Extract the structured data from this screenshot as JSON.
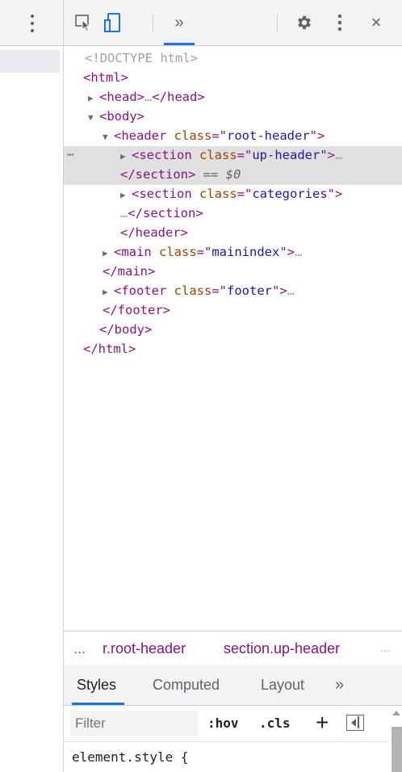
{
  "toolbar": {
    "icons": [
      "inspect-element-icon",
      "device-toolbar-icon"
    ],
    "more_tabs_label": "»",
    "close_label": "×"
  },
  "dom_tree": {
    "lines": [
      {
        "parts": [
          [
            "punct",
            "<!DOCTYPE html>"
          ]
        ]
      },
      {
        "parts": [
          [
            "tag",
            "<html"
          ],
          [
            "tag",
            ">"
          ]
        ]
      },
      {
        "parts": [
          [
            "tag",
            "<head>"
          ],
          [
            "punct",
            "…"
          ],
          [
            "tag",
            "</head>"
          ]
        ]
      },
      {
        "parts": [
          [
            "tag",
            "<body>"
          ]
        ]
      },
      {
        "parts": [
          [
            "tag",
            "<header "
          ],
          [
            "attr",
            "class"
          ],
          [
            "tag",
            "=\""
          ],
          [
            "val",
            "root-header"
          ],
          [
            "tag",
            "\">"
          ]
        ]
      },
      {
        "parts": [
          [
            "tag",
            "<section "
          ],
          [
            "attr",
            "class"
          ],
          [
            "tag",
            "=\""
          ],
          [
            "val",
            "up-header"
          ],
          [
            "tag",
            "\">"
          ],
          [
            "punct",
            "…"
          ]
        ]
      },
      {
        "parts": [
          [
            "tag",
            "</section>"
          ],
          [
            "eq0",
            " == "
          ],
          [
            "dollar0",
            "$0"
          ]
        ]
      },
      {
        "parts": [
          [
            "tag",
            "<section "
          ],
          [
            "attr",
            "class"
          ],
          [
            "tag",
            "=\""
          ],
          [
            "val",
            "categories"
          ],
          [
            "tag",
            "\">"
          ]
        ]
      },
      {
        "parts": [
          [
            "punct",
            "…"
          ],
          [
            "tag",
            "</section>"
          ]
        ]
      },
      {
        "parts": [
          [
            "tag",
            "</header>"
          ]
        ]
      },
      {
        "parts": [
          [
            "tag",
            "<main "
          ],
          [
            "attr",
            "class"
          ],
          [
            "tag",
            "=\""
          ],
          [
            "val",
            "mainindex"
          ],
          [
            "tag",
            "\">"
          ],
          [
            "punct",
            "…"
          ]
        ]
      },
      {
        "parts": [
          [
            "tag",
            "</main>"
          ]
        ]
      },
      {
        "parts": [
          [
            "tag",
            "<footer "
          ],
          [
            "attr",
            "class"
          ],
          [
            "tag",
            "=\""
          ],
          [
            "val",
            "footer"
          ],
          [
            "tag",
            "\">"
          ],
          [
            "punct",
            "…"
          ]
        ]
      },
      {
        "parts": [
          [
            "tag",
            "</footer>"
          ]
        ]
      },
      {
        "parts": [
          [
            "tag",
            "</body>"
          ]
        ]
      },
      {
        "parts": [
          [
            "tag",
            "</html>"
          ]
        ]
      }
    ],
    "selected_gutter": "⋯"
  },
  "breadcrumb": {
    "ellipsis_left": "...",
    "crumb1": "r.root-header",
    "crumb2": "section.up-header",
    "ellipsis_right": "..."
  },
  "styles_tabs": {
    "styles": "Styles",
    "computed": "Computed",
    "layout": "Layout",
    "more": "»"
  },
  "filter": {
    "placeholder": "Filter",
    "hov": ":hov",
    "cls": ".cls",
    "add": "+"
  },
  "rules": {
    "element_style": "element.style {"
  },
  "colors": {
    "tag": "#881280",
    "attr": "#994500",
    "value": "#1a1aa6",
    "accent": "#1a73e8",
    "selected_row": "#e0e0e0"
  }
}
